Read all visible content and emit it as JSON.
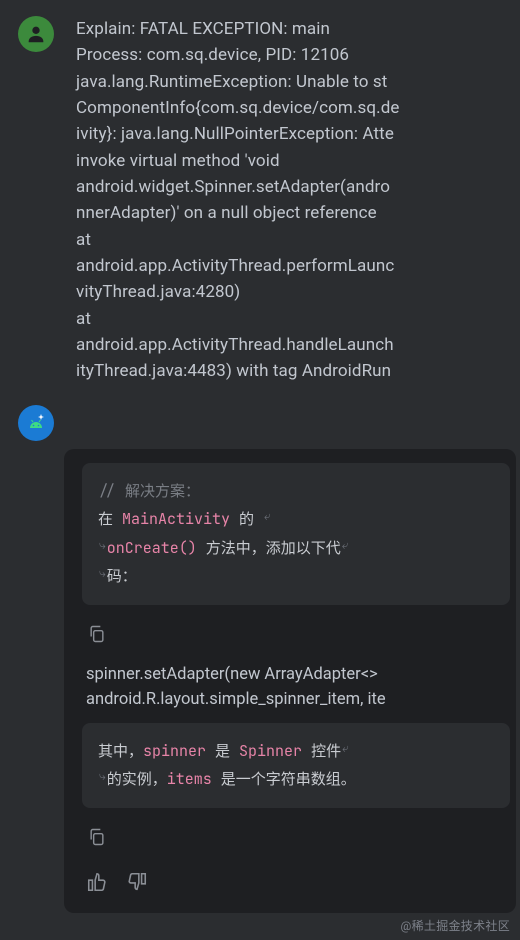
{
  "user_message": {
    "text": "Explain: FATAL EXCEPTION: main\nProcess: com.sq.device, PID: 12106\njava.lang.RuntimeException: Unable to st\nComponentInfo{com.sq.device/com.sq.de\nivity}: java.lang.NullPointerException: Atte\ninvoke virtual method 'void\nandroid.widget.Spinner.setAdapter(andro\nnnerAdapter)' on a null object reference\nat\nandroid.app.ActivityThread.performLaunc\nvityThread.java:4280)\nat\nandroid.app.ActivityThread.handleLaunch\nityThread.java:4483) with tag AndroidRun"
  },
  "bot_message": {
    "code_block_1": {
      "comment": "// 解决方案：",
      "line1_a": "在 ",
      "line1_kw": "MainActivity",
      "line1_b": " 的 ",
      "line2_kw": "onCreate()",
      "line2_b": " 方法中，添加以下代",
      "line3": "码："
    },
    "plain_1": "spinner.setAdapter(new ArrayAdapter<>\nandroid.R.layout.simple_spinner_item, ite",
    "code_block_2": {
      "l1_a": "其中，",
      "l1_kw1": "spinner",
      "l1_b": " 是 ",
      "l1_kw2": "Spinner",
      "l1_c": " 控件",
      "l2_a": "的实例，",
      "l2_kw": "items",
      "l2_b": " 是一个字符串数组。"
    }
  },
  "watermark": "@稀土掘金技术社区"
}
